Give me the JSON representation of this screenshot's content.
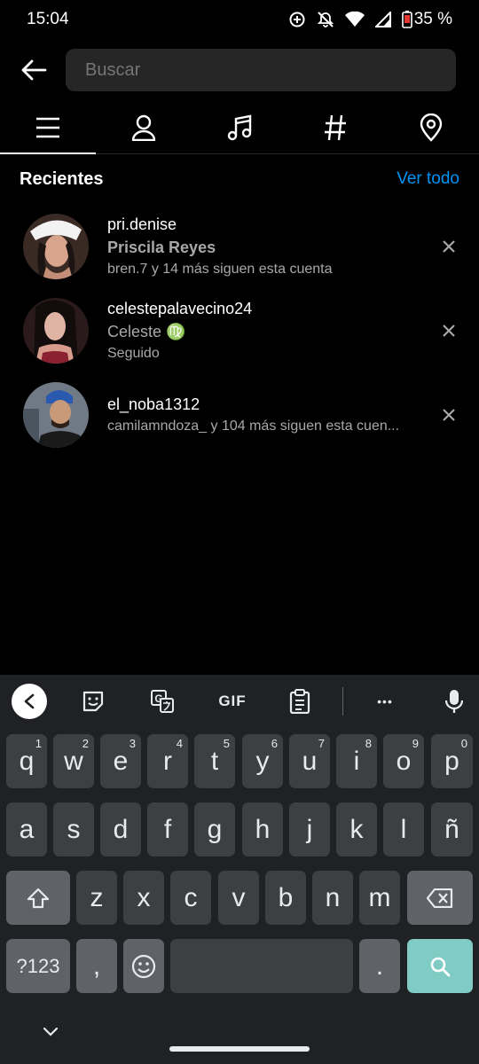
{
  "status_bar": {
    "time": "15:04",
    "battery": "35 %"
  },
  "search": {
    "placeholder": "Buscar"
  },
  "tabs": [
    {
      "name": "top",
      "icon": "menu-icon"
    },
    {
      "name": "accounts",
      "icon": "person-icon"
    },
    {
      "name": "audio",
      "icon": "music-note-icon"
    },
    {
      "name": "tags",
      "icon": "hashtag-icon"
    },
    {
      "name": "places",
      "icon": "location-pin-icon"
    }
  ],
  "recent": {
    "title": "Recientes",
    "see_all": "Ver todo",
    "items": [
      {
        "username": "pri.denise",
        "fullname": "Priscila Reyes",
        "sub": "bren.7 y 14 más siguen esta cuenta"
      },
      {
        "username": "celestepalavecino24",
        "fullname": "Celeste ♍",
        "sub": "Seguido"
      },
      {
        "username": "el_noba1312",
        "fullname": "",
        "sub": "camilamndoza_ y 104 más siguen esta cuen..."
      }
    ]
  },
  "keyboard": {
    "toolbar": {
      "gif": "GIF",
      "more": "•••"
    },
    "row1": [
      {
        "k": "q",
        "s": "1"
      },
      {
        "k": "w",
        "s": "2"
      },
      {
        "k": "e",
        "s": "3"
      },
      {
        "k": "r",
        "s": "4"
      },
      {
        "k": "t",
        "s": "5"
      },
      {
        "k": "y",
        "s": "6"
      },
      {
        "k": "u",
        "s": "7"
      },
      {
        "k": "i",
        "s": "8"
      },
      {
        "k": "o",
        "s": "9"
      },
      {
        "k": "p",
        "s": "0"
      }
    ],
    "row2": [
      "a",
      "s",
      "d",
      "f",
      "g",
      "h",
      "j",
      "k",
      "l",
      "ñ"
    ],
    "row3": [
      "z",
      "x",
      "c",
      "v",
      "b",
      "n",
      "m"
    ],
    "symbols": "?123",
    "comma": ",",
    "period": "."
  },
  "colors": {
    "accent": "#0095f6",
    "search_key": "#80cbc4"
  }
}
